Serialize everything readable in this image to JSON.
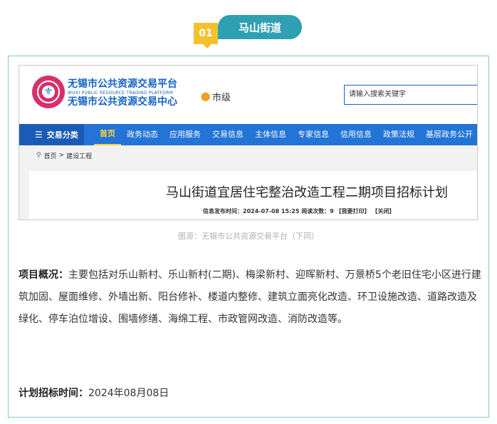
{
  "section": {
    "number": "01",
    "title": "马山街道"
  },
  "site": {
    "brand_line1": "无锡市公共资源交易平台",
    "brand_line2": "WUXI PUBLIC RESOURCE TRADING PLATFORM",
    "brand_line3": "无锡市公共资源交易中心",
    "location": "市级",
    "search_placeholder": "请输入搜索关键字",
    "nav_category": "交易分类",
    "nav_items": [
      "首页",
      "政务动态",
      "应用服务",
      "交易信息",
      "主体信息",
      "专家信息",
      "信用信息",
      "政策法规",
      "基层政务公开"
    ],
    "breadcrumb_home": "首页",
    "breadcrumb_sep": ">",
    "breadcrumb_current": "建设工程",
    "doc_title": "马山街道宜居住宅整治改造工程二期项目招标计划",
    "doc_meta": "信息发布时间：2024-07-08 15:25   阅读次数：9  【我要打印】  【关闭】"
  },
  "caption": "图源：无锡市公共资源交易平台（下同）",
  "overview": {
    "label": "项目概况：",
    "text": "主要包括对乐山新村、乐山新村(二期)、梅梁新村、迎晖新村、万景桥5个老旧住宅小区进行建筑加固、屋面维修、外墙出新、阳台修补、楼道内整修、建筑立面亮化改造、环卫设施改造、道路改造及绿化、停车泊位增设、围墙修缮、海绵工程、市政管网改造、消防改造等。"
  },
  "plan": {
    "label": "计划招标时间：",
    "date": "2024年08月08日"
  }
}
